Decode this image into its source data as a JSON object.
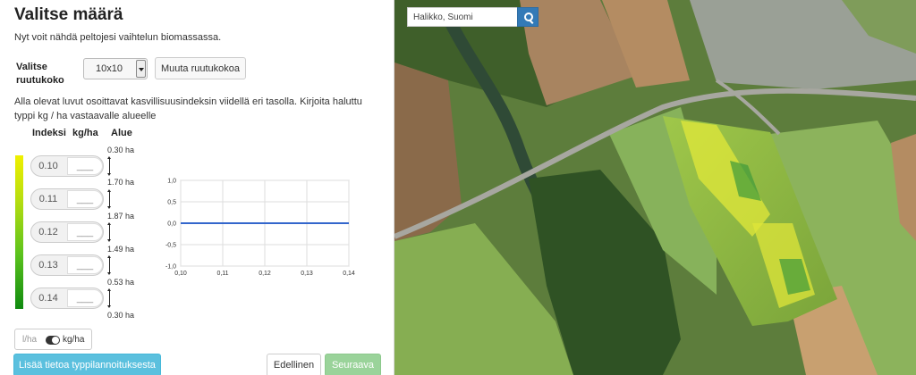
{
  "panel": {
    "title": "Valitse määrä",
    "subtitle": "Nyt voit nähdä peltojesi vaihtelun biomassassa.",
    "grid_label": "Valitse ruutukoko",
    "grid_value": "10x10",
    "resize_label": "Muuta ruutukokoa",
    "description": "Alla olevat luvut osoittavat kasvillisuusindeksin viidellä eri tasolla. Kirjoita haluttu typpi kg / ha vastaavalle alueelle",
    "columns": {
      "index": "Indeksi",
      "kgha": "kg/ha",
      "area": "Alue"
    },
    "rows": [
      {
        "index": "0.10",
        "kg": "___"
      },
      {
        "index": "0.11",
        "kg": "___"
      },
      {
        "index": "0.12",
        "kg": "___"
      },
      {
        "index": "0.13",
        "kg": "___"
      },
      {
        "index": "0.14",
        "kg": "___"
      }
    ],
    "areas": [
      "0.30 ha",
      "1.70 ha",
      "1.87 ha",
      "1.49 ha",
      "0.53 ha",
      "0.30 ha"
    ],
    "toggle": {
      "left": "l/ha",
      "right": "kg/ha"
    },
    "add_button": "Lisää tietoa typpilannoituksesta",
    "prev_button": "Edellinen",
    "next_button": "Seuraava"
  },
  "chart_data": {
    "type": "line",
    "x": [
      0.1,
      0.11,
      0.12,
      0.13,
      0.14
    ],
    "series": [
      {
        "values": [
          0.0,
          0.0,
          0.0,
          0.0,
          0.0
        ],
        "color": "#3366cc"
      }
    ],
    "xticks": [
      "0,10",
      "0,11",
      "0,12",
      "0,13",
      "0,14"
    ],
    "yticks": [
      "1,0",
      "0,5",
      "0,0",
      "-0,5",
      "-1,0"
    ],
    "ylim": [
      -1.0,
      1.0
    ],
    "xlim": [
      0.1,
      0.14
    ],
    "grid": true
  },
  "map": {
    "search_value": "Halikko, Suomi",
    "search_icon": "search-icon"
  },
  "colors": {
    "legend_top": "#f0f000",
    "legend_bottom": "#0f8a0f",
    "primary": "#337ab7",
    "info": "#5bc0de",
    "success": "#9ad39a"
  }
}
